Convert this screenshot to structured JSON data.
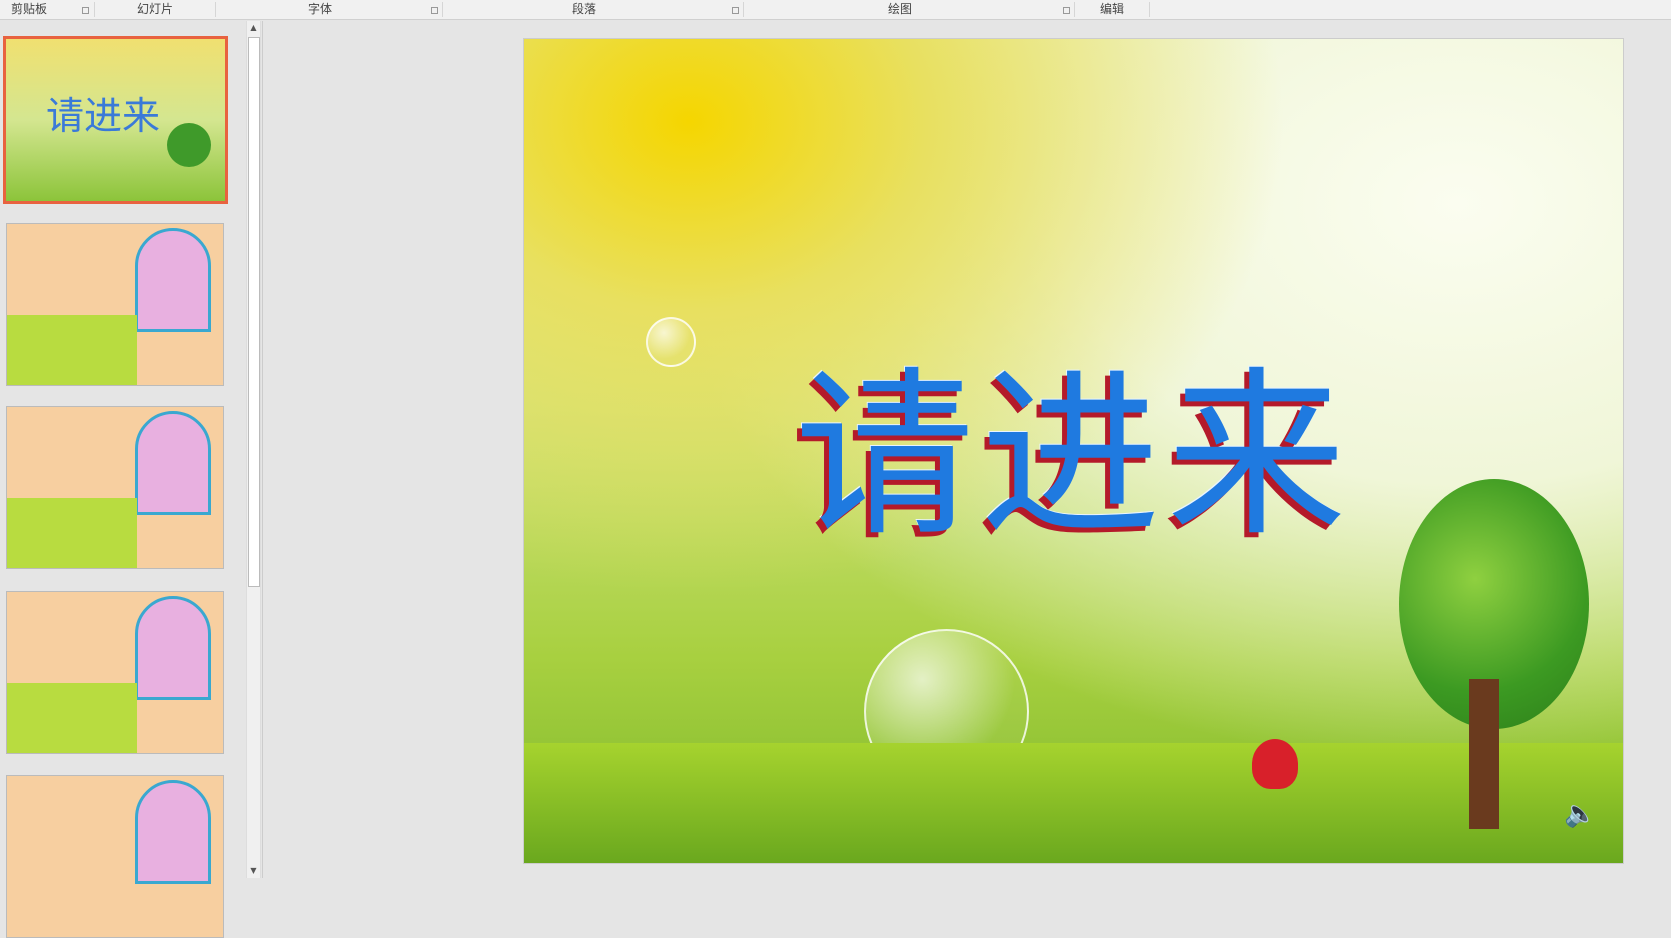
{
  "ribbon": {
    "groups": [
      "剪贴板",
      "幻灯片",
      "字体",
      "段落",
      "绘图",
      "编辑"
    ]
  },
  "slides": [
    {
      "title": "请进来",
      "selected": true
    },
    {
      "selected": false
    },
    {
      "selected": false
    },
    {
      "selected": false
    },
    {
      "selected": false
    }
  ],
  "main_slide": {
    "title": "请进来"
  },
  "colors": {
    "selection": "#e8623f",
    "title": "#1f7ae0",
    "title_shadow": "#b41a2a"
  }
}
